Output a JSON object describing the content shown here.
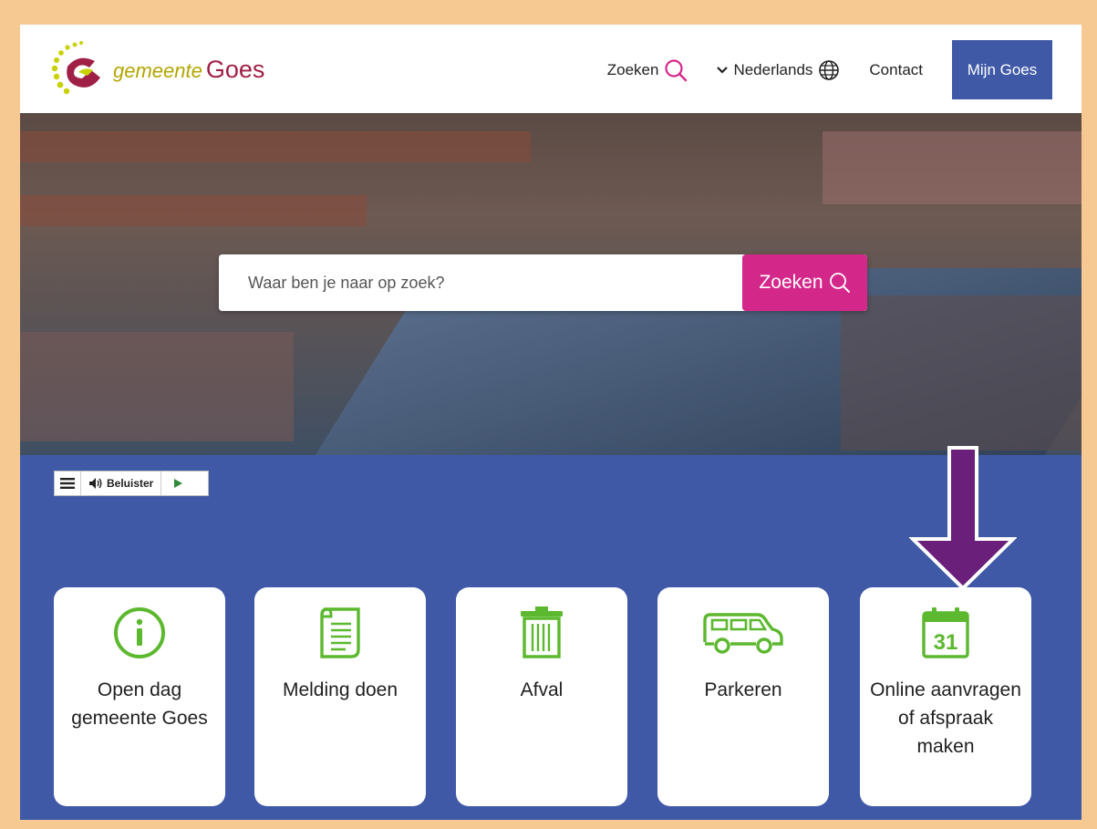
{
  "header": {
    "logo_prefix": "gemeente",
    "logo_name": "Goes",
    "nav": {
      "search_label": "Zoeken",
      "language_label": "Nederlands",
      "contact_label": "Contact",
      "account_label": "Mijn Goes"
    }
  },
  "hero": {
    "search_placeholder": "Waar ben je naar op zoek?",
    "search_button": "Zoeken"
  },
  "readspeaker": {
    "listen_label": "Beluister"
  },
  "tiles": [
    {
      "label": "Open dag gemeente Goes",
      "icon": "info-icon"
    },
    {
      "label": "Melding doen",
      "icon": "document-icon"
    },
    {
      "label": "Afval",
      "icon": "trash-icon"
    },
    {
      "label": "Parkeren",
      "icon": "car-icon"
    },
    {
      "label": "Online aanvragen of afspraak maken",
      "icon": "calendar-icon",
      "icon_text": "31"
    }
  ],
  "colors": {
    "primary_blue": "#3f59a7",
    "magenta": "#d4278a",
    "icon_green": "#5cb82e",
    "annotation_purple": "#6a1f7a",
    "frame": "#f6c892"
  }
}
